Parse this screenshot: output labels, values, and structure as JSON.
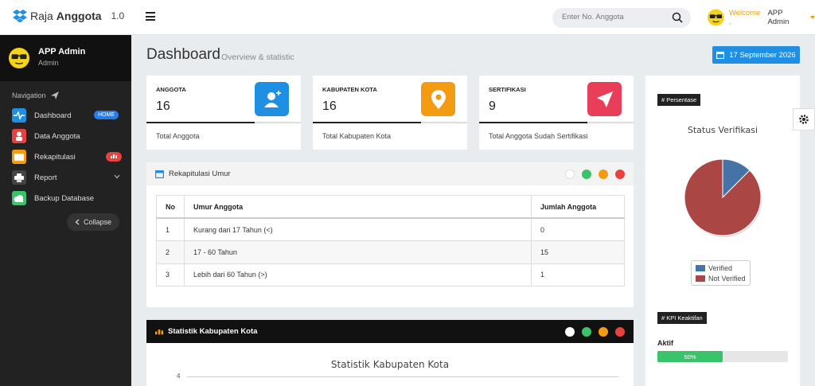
{
  "brand": {
    "name_light": "Raja ",
    "name_bold": "Anggota",
    "version": "1.0"
  },
  "search": {
    "placeholder": "Enter No. Anggota"
  },
  "topuser": {
    "welcome": "Welcome ,",
    "name": "APP Admin"
  },
  "sidebar": {
    "user_name": "APP Admin",
    "user_role": "Admin",
    "nav_label": "Navigation",
    "items": [
      {
        "label": "Dashboard",
        "badge": "HOME",
        "color": "#1f8fe3"
      },
      {
        "label": "Data Anggota",
        "color": "#e8423f"
      },
      {
        "label": "Rekapitulasi",
        "badge": "lul",
        "color": "#f39c12"
      },
      {
        "label": "Report",
        "color": "#555555"
      },
      {
        "label": "Backup Database",
        "color": "#3ac36a"
      }
    ],
    "collapse_label": "Collapse"
  },
  "header": {
    "title": "Dashboard",
    "subtitle": "Overview & statistic",
    "date": "17 September 2026"
  },
  "cards": [
    {
      "title": "ANGGOTA",
      "value": "16",
      "desc": "Total Anggota",
      "color": "#1f8fe3",
      "icon": "add-user-icon"
    },
    {
      "title": "KABUPATEN KOTA",
      "value": "16",
      "desc": "Total Kabupaten Kota",
      "color": "#f39c12",
      "icon": "map-pin-icon"
    },
    {
      "title": "SERTIFIKASI",
      "value": "9",
      "desc": "Total Anggota Sudah Sertifikasi",
      "color": "#e83e5a",
      "icon": "send-icon"
    }
  ],
  "rekap": {
    "title": "Rekapitulasi Umur",
    "headers": [
      "No",
      "Umur Anggota",
      "Jumlah Anggota"
    ],
    "rows": [
      [
        "1",
        "Kurang dari 17 Tahun (<)",
        "0"
      ],
      [
        "2",
        "17 - 60 Tahun",
        "15"
      ],
      [
        "3",
        "Lebih dari 60 Tahun (>)",
        "1"
      ]
    ]
  },
  "statistik": {
    "title": "Statistik Kabupaten Kota",
    "chart_title": "Statistik Kabupaten Kota",
    "y_first_tick": "4"
  },
  "persentase": {
    "tag": "# Persentase",
    "chart_title": "Status Verifikasi",
    "legend": [
      "Verified",
      "Not Verified"
    ]
  },
  "kpi": {
    "tag": "# KPI Keaktifan",
    "label": "Aktif",
    "progress_text": "50%",
    "progress": 0.5
  },
  "chart_data": {
    "type": "pie",
    "title": "Status Verifikasi",
    "categories": [
      "Verified",
      "Not Verified"
    ],
    "values": [
      2,
      14
    ],
    "colors": [
      "#4572a7",
      "#aa4643"
    ]
  }
}
